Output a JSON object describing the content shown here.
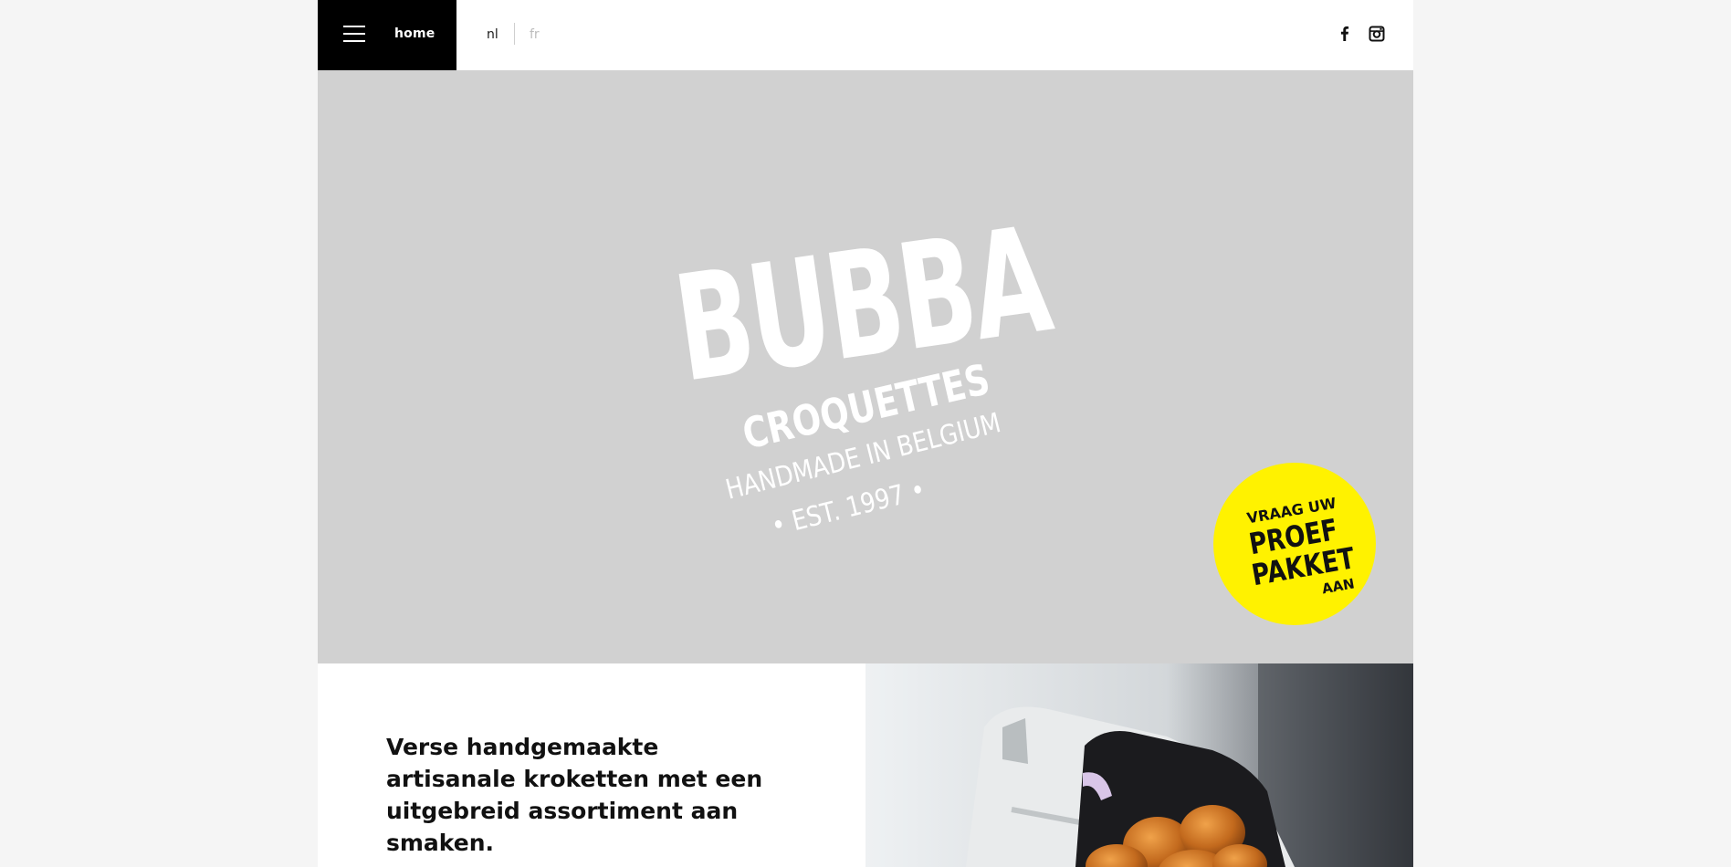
{
  "header": {
    "menu_label": "home",
    "languages": [
      {
        "code": "nl",
        "active": true
      },
      {
        "code": "fr",
        "active": false
      }
    ],
    "social": [
      "facebook-icon",
      "instagram-icon"
    ]
  },
  "hero": {
    "logo": {
      "brand": "BUBBA",
      "subtitle": "CROQUETTES",
      "tagline": "HANDMADE IN BELGIUM",
      "est": "• EST. 1997 •"
    },
    "badge": {
      "line1": "VRAAG UW",
      "line2": "PROEF",
      "line3": "PAKKET",
      "line4": "AAN"
    }
  },
  "intro": {
    "text": "Verse handgemaakte artisanale kroketten met een uitgebreid assortiment aan smaken."
  },
  "colors": {
    "header_menu_bg": "#000000",
    "hero_bg": "#d1d1d1",
    "badge_yellow": "#fff200",
    "page_bg": "#f5f5f5"
  }
}
